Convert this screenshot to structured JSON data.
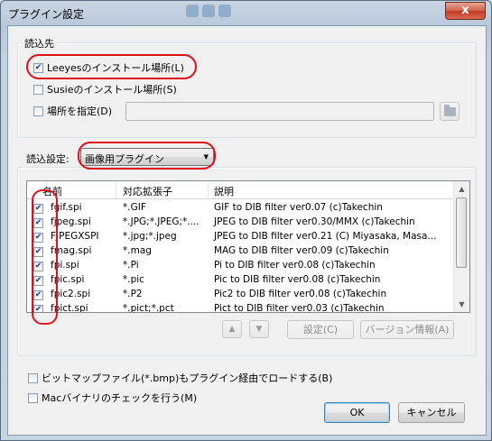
{
  "window": {
    "title": "プラグイン設定",
    "close_glyph": "x"
  },
  "source_group": {
    "label": "読込先",
    "options": [
      {
        "label": "Leeyesのインストール場所(L)",
        "checked": true
      },
      {
        "label": "Susieのインストール場所(S)",
        "checked": false
      },
      {
        "label": "場所を指定(D)",
        "checked": false
      }
    ],
    "path_value": ""
  },
  "settings_group": {
    "label": "読込設定:",
    "combo_value": "画像用プラグイン",
    "combo_arrow": "▼",
    "columns": [
      "名前",
      "対応拡張子",
      "説明"
    ],
    "rows": [
      {
        "name": "fgif.spi",
        "ext": "*.GIF",
        "desc": "GIF to DIB filter ver0.07 (c)Takechin",
        "checked": true
      },
      {
        "name": "fjpeg.spi",
        "ext": "*.JPG;*.JPEG;*....",
        "desc": "JPEG to DIB filter ver0.30/MMX (c)Takechin",
        "checked": true
      },
      {
        "name": "FJPEGXSPI",
        "ext": "*.jpg;*.jpeg",
        "desc": "JPEG to DIB filter ver0.21 (C) Miyasaka, Masa...",
        "checked": true
      },
      {
        "name": "fmag.spi",
        "ext": "*.mag",
        "desc": "MAG to DIB filter ver0.09 (c)Takechin",
        "checked": true
      },
      {
        "name": "fpi.spi",
        "ext": "*.Pi",
        "desc": "Pi to DIB filter ver0.08 (c)Takechin",
        "checked": true
      },
      {
        "name": "fpic.spi",
        "ext": "*.pic",
        "desc": "Pic to DIB filter ver0.08 (c)Takechin",
        "checked": true
      },
      {
        "name": "fpic2.spi",
        "ext": "*.P2",
        "desc": "Pic2 to DIB filter ver0.08 (c)Takechin",
        "checked": true
      },
      {
        "name": "fpict.spi",
        "ext": "*.pict;*.pct",
        "desc": "Pict to DIB filter ver0.03 (c)Takechin",
        "checked": true
      }
    ],
    "up_glyph": "▲",
    "down_glyph": "▼",
    "settings_button": "設定(C)",
    "version_button": "バージョン情報(A)"
  },
  "bottom": {
    "bitmap_option": {
      "label": "ビットマップファイル(*.bmp)もプラグイン経由でロードする(B)",
      "checked": false
    },
    "mac_option": {
      "label": "Macバイナリのチェックを行う(M)",
      "checked": false
    },
    "ok_button": "OK",
    "cancel_button": "キャンセル"
  },
  "colors": {
    "highlight": "#e0101a",
    "accent": "#3c7fb1"
  }
}
